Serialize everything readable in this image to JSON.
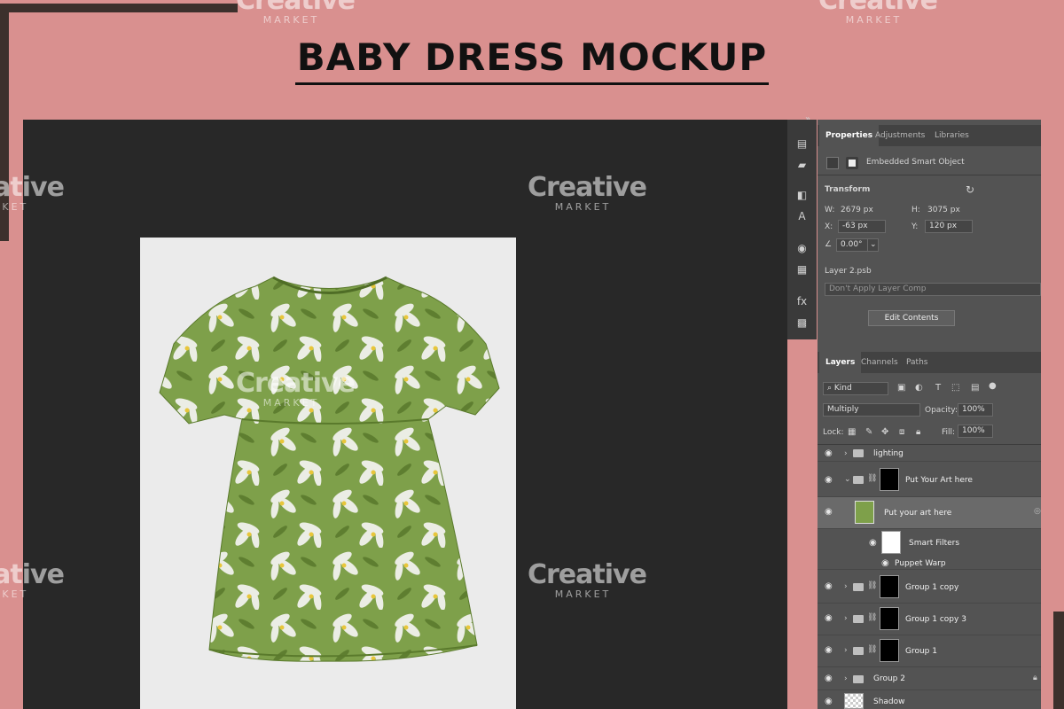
{
  "title": "BABY DRESS MOCKUP",
  "watermark": {
    "word": "Creative",
    "sub": "MARKET"
  },
  "colors": {
    "background": "#d9908f",
    "canvas": "#282828",
    "panel": "#535353",
    "dress_green": "#7ea04a"
  },
  "properties": {
    "tabs": [
      "Properties",
      "Adjustments",
      "Libraries"
    ],
    "object_type": "Embedded Smart Object",
    "transform_label": "Transform",
    "w_label": "W:",
    "w_value": "2679 px",
    "h_label": "H:",
    "h_value": "3075 px",
    "x_label": "X:",
    "x_value": "-63 px",
    "y_label": "Y:",
    "y_value": "120 px",
    "angle_value": "0.00°",
    "file_name": "Layer 2.psb",
    "layer_comp_placeholder": "Don't Apply Layer Comp",
    "edit_button": "Edit Contents"
  },
  "layers_panel": {
    "tabs": [
      "Layers",
      "Channels",
      "Paths"
    ],
    "filter_kind": "Kind",
    "blend_mode": "Multiply",
    "opacity_label": "Opacity:",
    "opacity_value": "100%",
    "lock_label": "Lock:",
    "fill_label": "Fill:",
    "fill_value": "100%",
    "layers": [
      {
        "name": "lighting"
      },
      {
        "name": "Put Your Art here"
      },
      {
        "name": "Put your art here"
      },
      {
        "name": "Smart Filters"
      },
      {
        "name": "Puppet Warp"
      },
      {
        "name": "Group 1 copy"
      },
      {
        "name": "Group 1 copy 3"
      },
      {
        "name": "Group 1"
      },
      {
        "name": "Group 2"
      },
      {
        "name": "Shadow"
      }
    ]
  }
}
